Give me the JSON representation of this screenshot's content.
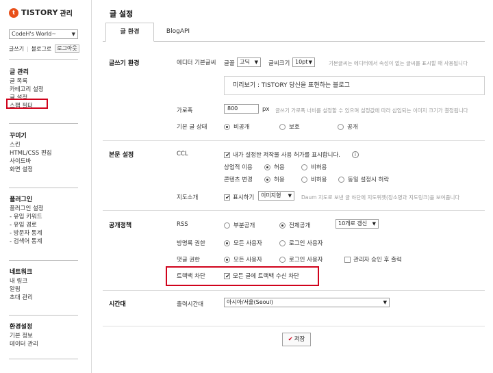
{
  "logo": {
    "mark": "t",
    "name": "TISTORY",
    "sub": "관리"
  },
  "blog": {
    "selected": "CodeH's World~"
  },
  "quick": {
    "write": "글쓰기",
    "blog": "블로그로",
    "logout": "로그아웃"
  },
  "nav": [
    {
      "title": "글 관리",
      "items": [
        "글 목록",
        "카테고리 설정",
        "글 설정",
        "스팸 필터"
      ]
    },
    {
      "title": "꾸미기",
      "items": [
        "스킨",
        "HTML/CSS 편집",
        "사이드바",
        "화면 설정"
      ]
    },
    {
      "title": "플러그인",
      "items": [
        "플러그인 설정",
        "- 유입 키워드",
        "- 유입 경로",
        "- 방문자 통계",
        "- 검색어 통계"
      ]
    },
    {
      "title": "네트워크",
      "items": [
        "내 링크",
        "알림",
        "초대 관리"
      ]
    },
    {
      "title": "환경설정",
      "items": [
        "기본 정보",
        "데이터 관리"
      ]
    }
  ],
  "page": {
    "title": "글 설정"
  },
  "tabs": [
    "글 환경",
    "BlogAPI"
  ],
  "sections": {
    "write_env": {
      "label": "글쓰기 환경",
      "editor_font_label": "에디터 기본글씨",
      "font_label": "글꼴",
      "font_value": "고딕",
      "size_label": "글씨크기",
      "size_value": "10pt",
      "font_help": "기본글씨는 에디터에서 속성이 없는 글씨를 표시할 때 사용됩니다",
      "preview": "미리보기 : TISTORY 당신을 표현하는 블로그",
      "width_label": "가로폭",
      "width_value": "800",
      "width_unit": "px",
      "width_help": "글쓰기 가로폭 너비를 설정할 수 있으며 설정값에 따라 삽입되는 이미지 크기가 결정됩니다",
      "status_label": "기본 글 상태",
      "status_options": [
        "비공개",
        "보호",
        "공개"
      ]
    },
    "body": {
      "label": "본문 설정",
      "ccl_label": "CCL",
      "ccl_check": "내가 설정한 저작물 사용 허가를 표시합니다.",
      "info_icon": "i",
      "commercial_label": "상업적 이용",
      "commercial_options": [
        "허용",
        "비허용"
      ],
      "modify_label": "콘텐츠 변경",
      "modify_options": [
        "허용",
        "비허용",
        "동일 설정시 허락"
      ],
      "map_label": "지도소개",
      "map_check": "표시하기",
      "map_select": "이미지형",
      "map_help": "Daum 지도로 보낸 글 하단에 지도위젯(장소명과 지도링크)을 보여줍니다"
    },
    "publish": {
      "label": "공개정책",
      "rss_label": "RSS",
      "rss_options": [
        "부분공개",
        "전체공개"
      ],
      "rss_select": "10개로 갱신",
      "guestbook_label": "방명록 권한",
      "guestbook_options": [
        "모든 사용자",
        "로그인 사용자"
      ],
      "comment_label": "댓글 권한",
      "comment_options": [
        "모든 사용자",
        "로그인 사용자"
      ],
      "comment_check": "관리자 승인 후 출력",
      "trackback_label": "트랙백 차단",
      "trackback_check": "모든 글에 트랙백 수신 차단"
    },
    "timezone": {
      "label": "시간대",
      "output_label": "출력시간대",
      "value": "아시아/서울(Seoul)"
    }
  },
  "save": {
    "mark": "✔",
    "label": "저장"
  }
}
